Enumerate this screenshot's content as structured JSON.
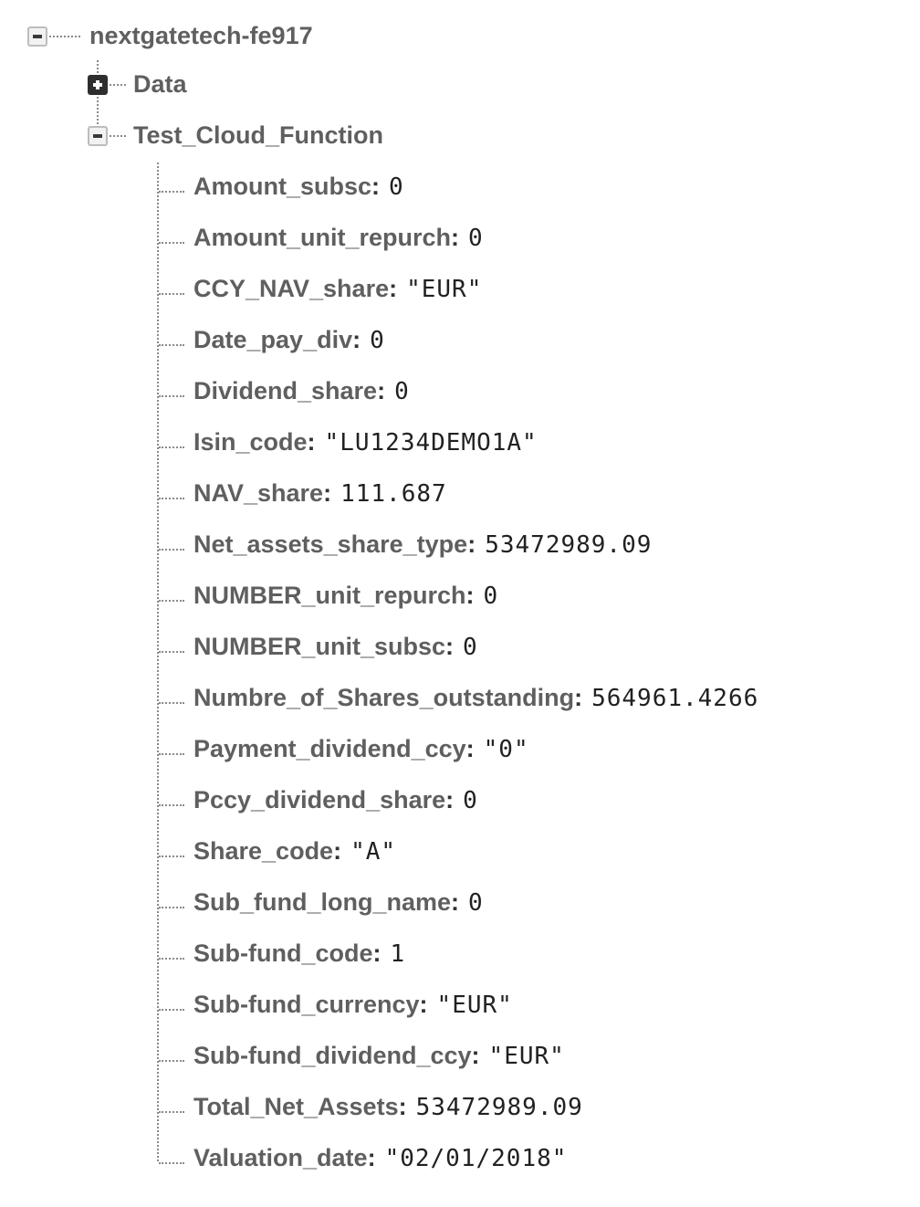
{
  "root": {
    "name": "nextgatetech-fe917",
    "expanded": true
  },
  "children": [
    {
      "name": "Data",
      "expanded": false
    },
    {
      "name": "Test_Cloud_Function",
      "expanded": true
    }
  ],
  "fields": [
    {
      "key": "Amount_subsc",
      "value": "0"
    },
    {
      "key": "Amount_unit_repurch",
      "value": "0"
    },
    {
      "key": "CCY_NAV_share",
      "value": "\"EUR\""
    },
    {
      "key": "Date_pay_div",
      "value": "0"
    },
    {
      "key": "Dividend_share",
      "value": "0"
    },
    {
      "key": "Isin_code",
      "value": "\"LU1234DEMO1A\""
    },
    {
      "key": "NAV_share",
      "value": "111.687"
    },
    {
      "key": "Net_assets_share_type",
      "value": "53472989.09"
    },
    {
      "key": "NUMBER_unit_repurch",
      "value": "0"
    },
    {
      "key": "NUMBER_unit_subsc",
      "value": "0"
    },
    {
      "key": "Numbre_of_Shares_outstanding",
      "value": "564961.4266"
    },
    {
      "key": "Payment_dividend_ccy",
      "value": "\"0\""
    },
    {
      "key": "Pccy_dividend_share",
      "value": "0"
    },
    {
      "key": "Share_code",
      "value": "\"A\""
    },
    {
      "key": "Sub_fund_long_name",
      "value": "0"
    },
    {
      "key": "Sub-fund_code",
      "value": "1"
    },
    {
      "key": "Sub-fund_currency",
      "value": "\"EUR\""
    },
    {
      "key": "Sub-fund_dividend_ccy",
      "value": "\"EUR\""
    },
    {
      "key": "Total_Net_Assets",
      "value": "53472989.09"
    },
    {
      "key": "Valuation_date",
      "value": "\"02/01/2018\""
    }
  ],
  "separator": ":"
}
